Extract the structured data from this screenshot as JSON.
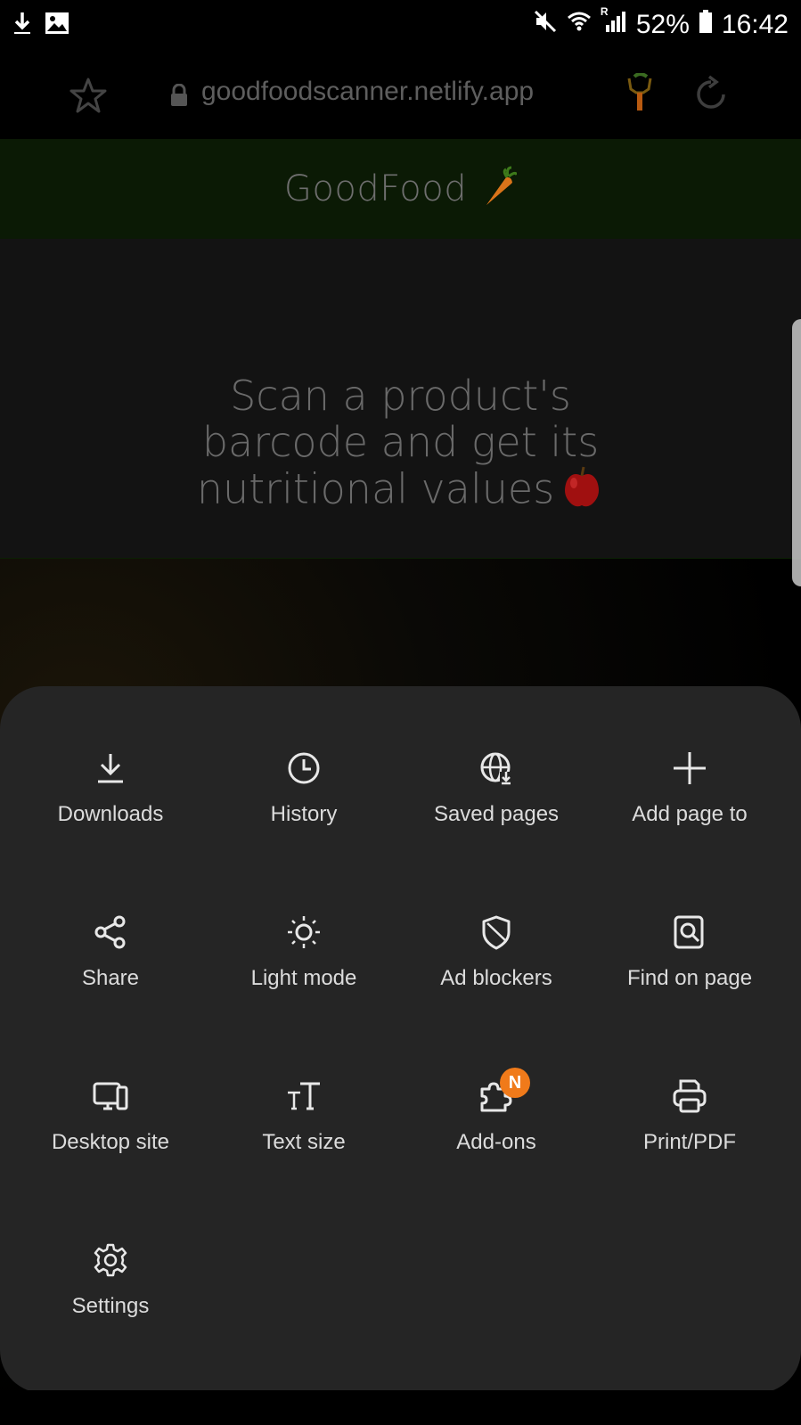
{
  "status_bar": {
    "battery": "52%",
    "time": "16:42",
    "network_indicator": "R"
  },
  "browser": {
    "url": "goodfoodscanner.netlify.app"
  },
  "site": {
    "brand": "GoodFood",
    "tagline_line1": "Scan a product's",
    "tagline_line2": "barcode and get its",
    "tagline_line3": "nutritional values"
  },
  "menu": {
    "items": [
      {
        "label": "Downloads",
        "icon": "download-icon"
      },
      {
        "label": "History",
        "icon": "clock-icon"
      },
      {
        "label": "Saved pages",
        "icon": "globe-download-icon"
      },
      {
        "label": "Add page to",
        "icon": "plus-icon"
      },
      {
        "label": "Share",
        "icon": "share-icon"
      },
      {
        "label": "Light mode",
        "icon": "sun-icon"
      },
      {
        "label": "Ad blockers",
        "icon": "shield-icon"
      },
      {
        "label": "Find on page",
        "icon": "find-icon"
      },
      {
        "label": "Desktop site",
        "icon": "desktop-icon"
      },
      {
        "label": "Text size",
        "icon": "text-size-icon"
      },
      {
        "label": "Add-ons",
        "icon": "puzzle-icon",
        "badge": "N"
      },
      {
        "label": "Print/PDF",
        "icon": "printer-icon"
      },
      {
        "label": "Settings",
        "icon": "gear-icon"
      }
    ]
  },
  "colors": {
    "sheet_background": "#252525",
    "badge": "#f07a1a",
    "header_green": "#0b1a05"
  }
}
